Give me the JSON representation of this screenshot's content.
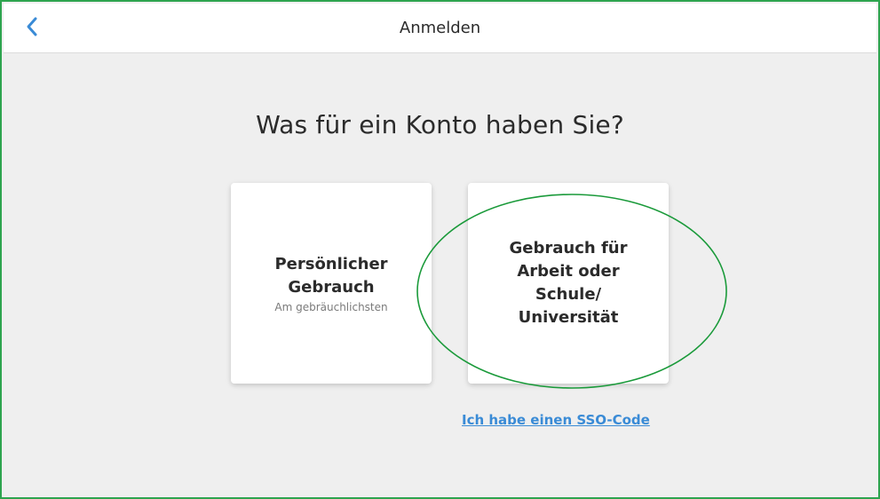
{
  "header": {
    "title": "Anmelden",
    "back_icon": "chevron-left-icon"
  },
  "main": {
    "heading": "Was für ein Konto haben Sie?",
    "cards": [
      {
        "title": "Persönlicher Gebrauch",
        "subtitle": "Am gebräuchlichsten"
      },
      {
        "title": "Gebrauch für Arbeit oder Schule/ Universität"
      }
    ],
    "sso_link": "Ich habe einen SSO-Code"
  },
  "colors": {
    "frame_border": "#2ea44f",
    "background": "#efefef",
    "link": "#3a8bd6",
    "back_icon": "#3a8bd6",
    "annotation": "#1a9a3a"
  }
}
